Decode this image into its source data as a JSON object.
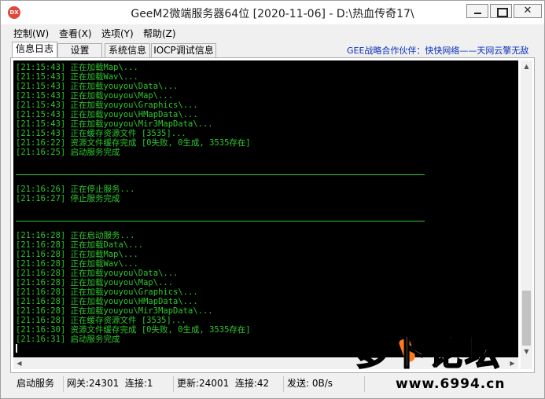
{
  "window": {
    "app_icon": "DX",
    "title": "GeeM2微端服务器64位 [2020-11-06] - D:\\热血传奇17\\",
    "controls": {
      "minimize": "minimize-icon",
      "maximize": "maximize-icon",
      "close": "✕"
    }
  },
  "menu": [
    "控制(W)",
    "查看(X)",
    "选项(Y)",
    "帮助(Z)"
  ],
  "tabs": [
    "信息日志",
    "设置",
    "系统信息",
    "IOCP调试信息"
  ],
  "active_tab": 0,
  "partner_text": "GEE战略合作伙伴：快快网络——天网云擎无敌",
  "log": {
    "block1": [
      "[21:15:43] 正在加载Map\\...",
      "[21:15:43] 正在加载Wav\\...",
      "[21:15:43] 正在加载youyou\\Data\\...",
      "[21:15:43] 正在加载youyou\\Map\\...",
      "[21:15:43] 正在加载youyou\\Graphics\\...",
      "[21:15:43] 正在加载youyou\\HMapData\\...",
      "[21:15:43] 正在加载youyou\\Mir3MapData\\...",
      "[21:15:43] 正在缓存资源文件 [3535]...",
      "[21:16:22] 资源文件缓存完成 [0失败, 0生成, 3535存在]",
      "[21:16:25] 启动服务完成"
    ],
    "block2": [
      "[21:16:26] 正在停止服务...",
      "[21:16:27] 停止服务完成"
    ],
    "block3": [
      "[21:16:28] 正在启动服务...",
      "[21:16:28] 正在加载Data\\...",
      "[21:16:28] 正在加载Map\\...",
      "[21:16:28] 正在加载Wav\\...",
      "[21:16:28] 正在加载youyou\\Data\\...",
      "[21:16:28] 正在加载youyou\\Map\\...",
      "[21:16:28] 正在加载youyou\\Graphics\\...",
      "[21:16:28] 正在加载youyou\\HMapData\\...",
      "[21:16:28] 正在加载youyou\\Mir3MapData\\...",
      "[21:16:28] 正在缓存资源文件 [3535]...",
      "[21:16:30] 资源文件缓存完成 [0失败, 0生成, 3535存在]",
      "[21:16:31] 启动服务完成"
    ]
  },
  "status": {
    "state": "启动服务",
    "gateway": "网关:24301",
    "gateway_conn": "连接:1",
    "update": "更新:24001",
    "update_conn": "连接:42",
    "send": "发送: 0B/s"
  },
  "watermark": {
    "logo_text": "萝卜论坛",
    "url": "www.6994.cn"
  },
  "colors": {
    "console_bg": "#000000",
    "console_text": "#2ec82e",
    "partner_text": "#0a2fbd"
  }
}
